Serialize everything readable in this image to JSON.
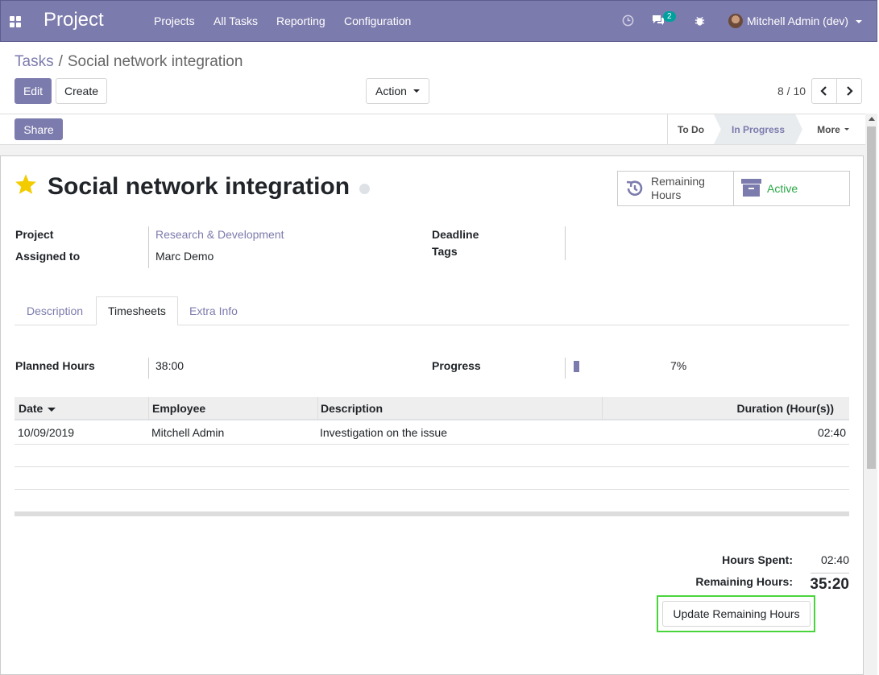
{
  "navbar": {
    "brand": "Project",
    "menus": [
      "Projects",
      "All Tasks",
      "Reporting",
      "Configuration"
    ],
    "chat_badge": "2",
    "user": "Mitchell Admin (dev)"
  },
  "breadcrumb": {
    "parent": "Tasks",
    "separator": "/",
    "current": "Social network integration"
  },
  "toolbar": {
    "edit_label": "Edit",
    "create_label": "Create",
    "action_label": "Action",
    "pager": "8 / 10"
  },
  "statusbar": {
    "share_label": "Share",
    "stages": [
      "To Do",
      "In Progress",
      "More"
    ],
    "active_stage": "In Progress"
  },
  "task": {
    "title": "Social network integration",
    "starred": true,
    "smart_buttons": {
      "remaining_line1": "Remaining",
      "remaining_line2": "Hours",
      "active_label": "Active"
    },
    "fields": {
      "project_label": "Project",
      "project_value": "Research & Development",
      "assigned_label": "Assigned to",
      "assigned_value": "Marc Demo",
      "deadline_label": "Deadline",
      "tags_label": "Tags"
    }
  },
  "tabs": [
    "Description",
    "Timesheets",
    "Extra Info"
  ],
  "active_tab": "Timesheets",
  "timesheets": {
    "planned_label": "Planned Hours",
    "planned_value": "38:00",
    "progress_label": "Progress",
    "progress_value": "7%",
    "progress_fraction": 0.07,
    "columns": [
      "Date",
      "Employee",
      "Description",
      "Duration (Hour(s))"
    ],
    "rows": [
      {
        "date": "10/09/2019",
        "employee": "Mitchell Admin",
        "description": "Investigation on the issue",
        "duration": "02:40"
      }
    ],
    "hours_spent_label": "Hours Spent:",
    "hours_spent_value": "02:40",
    "remaining_label": "Remaining Hours:",
    "remaining_value": "35:20",
    "update_button": "Update Remaining Hours"
  },
  "colors": {
    "brand": "#7c7bad",
    "active_green": "#28a745",
    "star": "#f3cc00",
    "highlight": "#4ad43c"
  }
}
